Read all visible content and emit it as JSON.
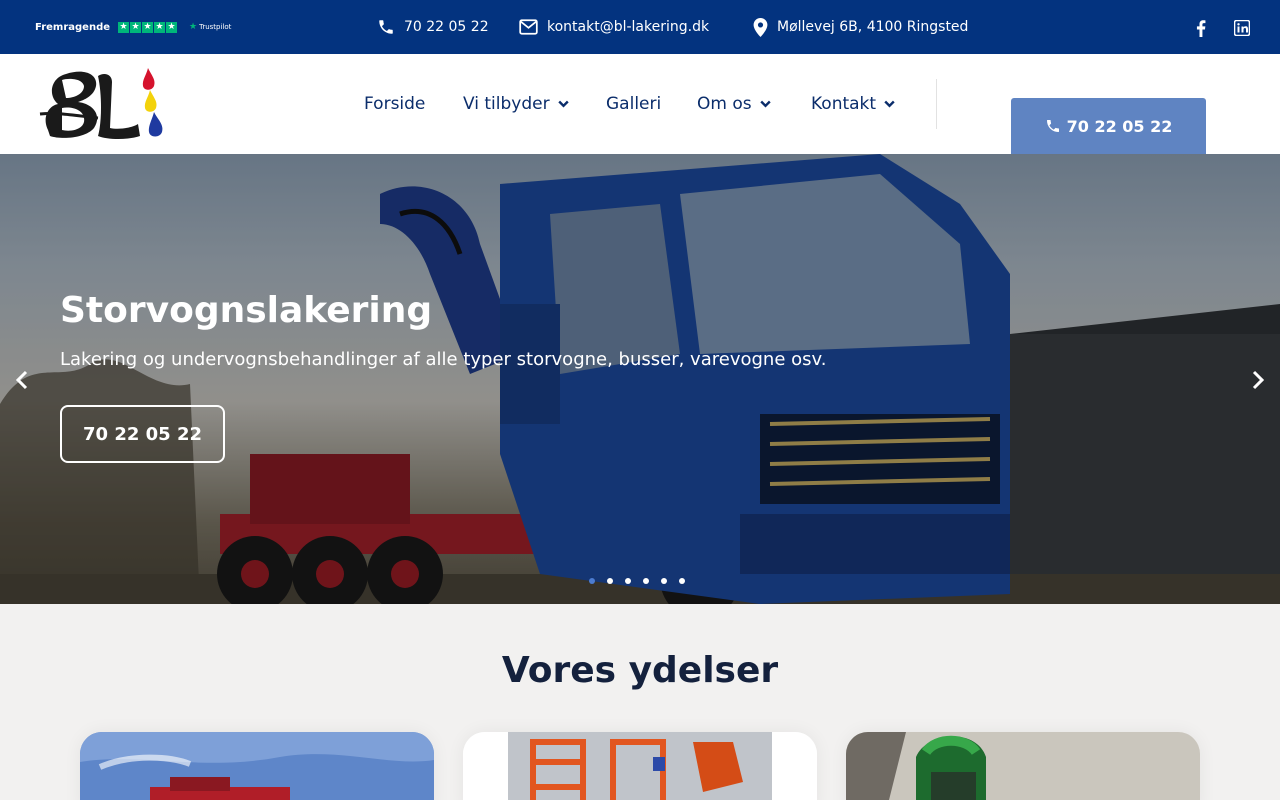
{
  "topbar": {
    "trustpilot_rating": "Fremragende",
    "trustpilot_name": "Trustpilot",
    "phone": "70 22 05 22",
    "email": "kontakt@bl-lakering.dk",
    "address": "Møllevej 6B, 4100 Ringsted",
    "bg_color": "#03337f"
  },
  "header": {
    "logo_text": "BL",
    "nav": [
      {
        "label": "Forside"
      },
      {
        "label": "Vi tilbyder"
      },
      {
        "label": "Galleri"
      },
      {
        "label": "Om os"
      },
      {
        "label": "Kontakt"
      }
    ],
    "cta_label": "70 22 05 22",
    "cta_color": "#5f84c2"
  },
  "hero": {
    "title": "Storvognslakering",
    "subtitle": "Lakering og undervognsbehandlinger af alle typer storvogne, busser, varevogne osv.",
    "button_label": "70 22 05 22",
    "slide_count": 6,
    "active_slide": 1
  },
  "services": {
    "title": "Vores ydelser",
    "cards": [
      {
        "image": "truck-photo"
      },
      {
        "image": "lift-photo"
      },
      {
        "image": "painter-photo"
      }
    ]
  }
}
